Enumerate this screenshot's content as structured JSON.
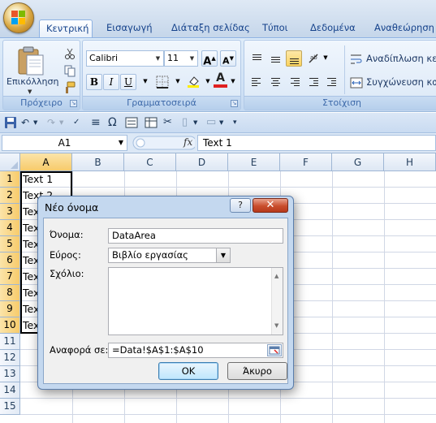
{
  "ribbon": {
    "tabs": [
      "Κεντρική",
      "Εισαγωγή",
      "Διάταξη σελίδας",
      "Τύποι",
      "Δεδομένα",
      "Αναθεώρηση"
    ],
    "active_tab": "Κεντρική",
    "clipboard": {
      "paste_label": "Επικόλληση",
      "group_label": "Πρόχειρο"
    },
    "font": {
      "family": "Calibri",
      "size": "11",
      "bold": "B",
      "italic": "I",
      "underline": "U",
      "grow": "A",
      "shrink": "A",
      "color_letter": "A",
      "group_label": "Γραμματοσειρά"
    },
    "alignment": {
      "wrap_text": "Αναδίπλωση κειμ",
      "merge_center": "Συγχώνευση και",
      "group_label": "Στοίχιση"
    }
  },
  "formula_bar": {
    "name_box": "A1",
    "fx": "fx",
    "content": "Text 1"
  },
  "sheet": {
    "columns": [
      "A",
      "B",
      "C",
      "D",
      "E",
      "F",
      "G",
      "H"
    ],
    "rows": [
      "1",
      "2",
      "3",
      "4",
      "5",
      "6",
      "7",
      "8",
      "9",
      "10",
      "11",
      "12",
      "13",
      "14",
      "15"
    ],
    "cells_a": [
      "Text 1",
      "Text 2",
      "Tex",
      "Tex",
      "Tex",
      "Tex",
      "Tex",
      "Tex",
      "Tex",
      "Tex"
    ]
  },
  "dialog": {
    "title": "Νέο όνομα",
    "help": "?",
    "close": "✕",
    "name_label": "Όνομα:",
    "name_value": "DataArea",
    "scope_label": "Εύρος:",
    "scope_value": "Βιβλίο εργασίας",
    "comment_label": "Σχόλιο:",
    "comment_value": "",
    "ref_label": "Αναφορά σε:",
    "ref_value": "=Data!$A$1:$A$10",
    "ok": "OK",
    "cancel": "Άκυρο"
  },
  "colors": {
    "accent": "#15428b",
    "selection": "#f7cb6b",
    "dialog_frame": "#c4d8ef"
  }
}
